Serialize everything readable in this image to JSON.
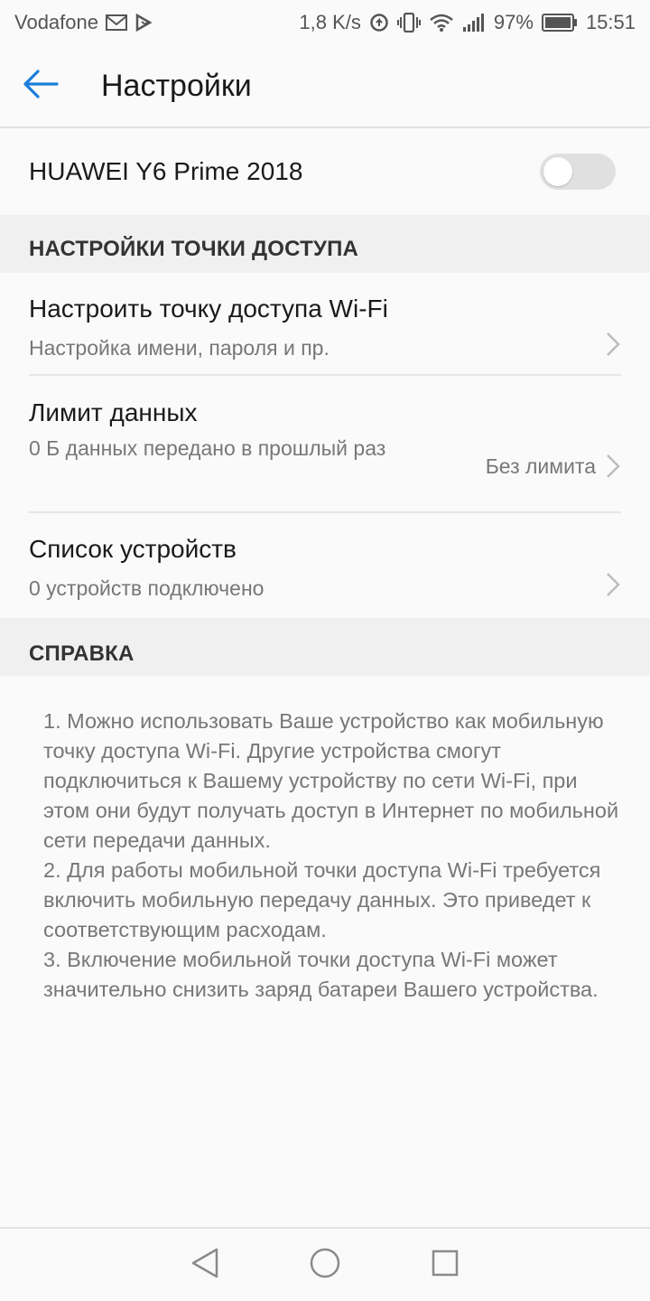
{
  "status_bar": {
    "carrier": "Vodafone",
    "speed": "1,8 K/s",
    "battery": "97%",
    "time": "15:51",
    "icons": [
      "mail-icon",
      "notification-icon",
      "data-saver-icon",
      "vibrate-icon",
      "wifi-icon",
      "signal-icon",
      "battery-icon"
    ]
  },
  "app_bar": {
    "title": "Настройки",
    "back_icon": "arrow-left-icon",
    "accent_color": "#1a7fdb"
  },
  "hotspot_toggle": {
    "label": "HUAWEI Y6 Prime 2018",
    "enabled": false
  },
  "sections": {
    "hotspot_header": "НАСТРОЙКИ ТОЧКИ ДОСТУПА",
    "help_header": "СПРАВКА"
  },
  "items": {
    "wifi": {
      "title": "Настроить точку доступа Wi-Fi",
      "subtitle": "Настройка имени, пароля и пр."
    },
    "limit": {
      "title": "Лимит данных",
      "subtitle": "0 Б данных передано в прошлый раз",
      "value": "Без лимита"
    },
    "devices": {
      "title": "Список устройств",
      "subtitle": "0 устройств подключено"
    }
  },
  "help": {
    "p1": "1. Можно использовать Ваше устройство как мобильную точку доступа Wi-Fi. Другие устройства смогут подключиться к Вашему устройству по сети Wi-Fi, при этом они будут получать доступ в Интернет по мобильной сети передачи данных.",
    "p2": "2. Для работы мобильной точки доступа Wi-Fi требуется включить мобильную передачу данных. Это приведет к соответствующим расходам.",
    "p3": "3. Включение мобильной точки доступа Wi-Fi может значительно снизить заряд батареи Вашего устройства."
  },
  "nav_bar": {
    "icons": [
      "back-triangle-icon",
      "home-circle-icon",
      "recents-square-icon"
    ]
  }
}
